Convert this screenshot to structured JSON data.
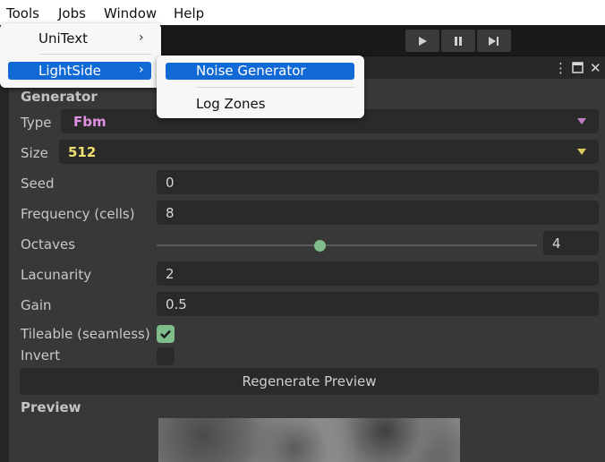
{
  "menubar": {
    "items": [
      "Tools",
      "Jobs",
      "Window",
      "Help"
    ]
  },
  "tools_menu": {
    "items": [
      {
        "label": "UniText"
      },
      {
        "label": "LightSide"
      }
    ]
  },
  "lightside_submenu": {
    "items": [
      {
        "label": "Noise Generator"
      },
      {
        "label": "Log Zones"
      }
    ]
  },
  "toolbar": {
    "icons": [
      "play-icon",
      "pause-icon",
      "step-icon"
    ]
  },
  "window_controls": {
    "icons": [
      "more-icon",
      "maximize-icon",
      "close-icon"
    ]
  },
  "generator": {
    "section_title": "Generator",
    "type": {
      "label": "Type",
      "value": "Fbm",
      "color": "#e090e0"
    },
    "size": {
      "label": "Size",
      "value": "512",
      "color": "#f0e070"
    },
    "seed": {
      "label": "Seed",
      "value": "0"
    },
    "frequency": {
      "label": "Frequency (cells)",
      "value": "8"
    },
    "octaves": {
      "label": "Octaves",
      "value": "4",
      "slider_fraction": 0.43
    },
    "lacunarity": {
      "label": "Lacunarity",
      "value": "2"
    },
    "gain": {
      "label": "Gain",
      "value": "0.5"
    },
    "tileable": {
      "label": "Tileable (seamless)",
      "checked": true
    },
    "invert": {
      "label": "Invert",
      "checked": false
    },
    "regenerate_label": "Regenerate Preview"
  },
  "preview": {
    "section_title": "Preview"
  },
  "colors": {
    "accent": "#7fbd8a",
    "menu_highlight": "#1169d6"
  }
}
